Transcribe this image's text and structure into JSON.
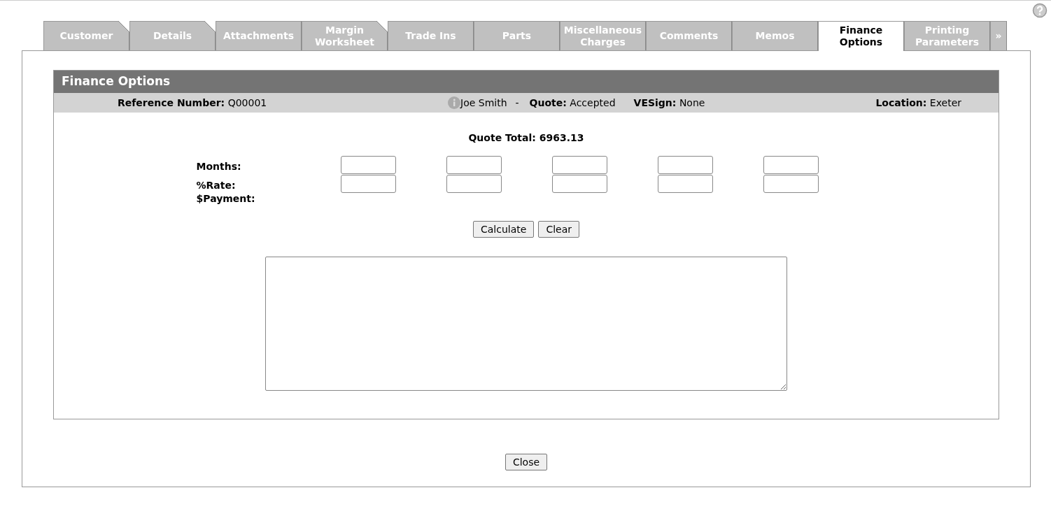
{
  "tabs": [
    {
      "label": "Customer",
      "selected": false,
      "flagged": true
    },
    {
      "label": "Details",
      "selected": false,
      "flagged": true
    },
    {
      "label": "Attachments",
      "selected": false,
      "flagged": false
    },
    {
      "label": "Margin Worksheet",
      "selected": false,
      "flagged": true
    },
    {
      "label": "Trade Ins",
      "selected": false,
      "flagged": false
    },
    {
      "label": "Parts",
      "selected": false,
      "flagged": false
    },
    {
      "label": "Miscellaneous Charges",
      "selected": false,
      "flagged": false
    },
    {
      "label": "Comments",
      "selected": false,
      "flagged": false
    },
    {
      "label": "Memos",
      "selected": false,
      "flagged": false
    },
    {
      "label": "Finance Options",
      "selected": true,
      "flagged": false
    },
    {
      "label": "Printing Parameters",
      "selected": false,
      "flagged": false
    }
  ],
  "more_tabs": "»",
  "panel": {
    "title": "Finance Options",
    "info": {
      "reference_label": "Reference Number:",
      "reference": "Q00001",
      "customer": "Joe Smith",
      "separator": "-",
      "quote_label": "Quote:",
      "quote": "Accepted",
      "vesign_label": "VESign:",
      "vesign": "None",
      "location_label": "Location:",
      "location": "Exeter"
    },
    "quote_total": "Quote Total: 6963.13",
    "rows": [
      {
        "label": "Months:",
        "kind": "inputs"
      },
      {
        "label": "%Rate:",
        "kind": "inputs"
      },
      {
        "label": "$Payment:",
        "kind": "plain"
      }
    ],
    "buttons": [
      "Calculate",
      "Clear"
    ]
  },
  "close_button": "Close"
}
